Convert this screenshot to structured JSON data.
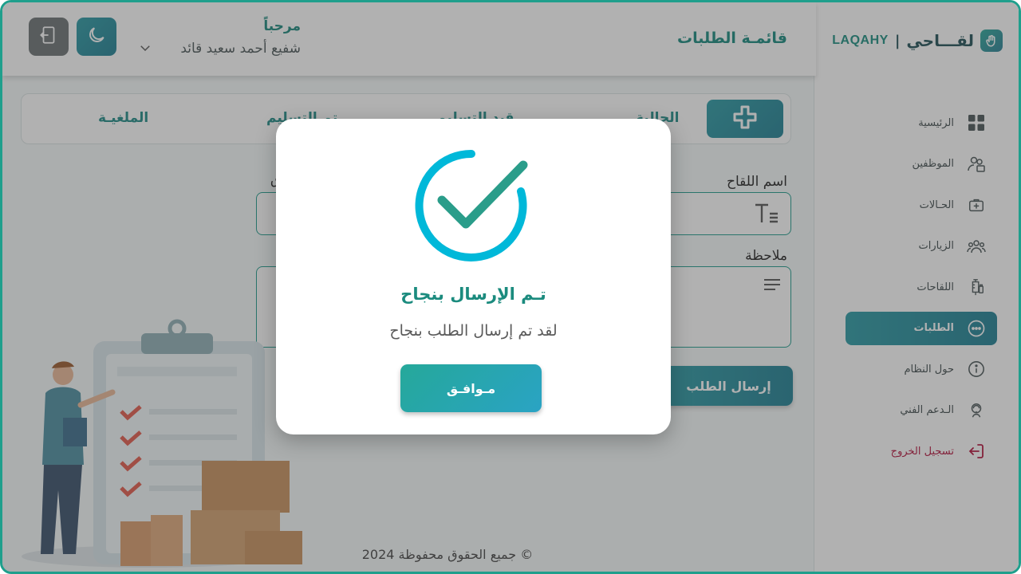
{
  "brand": {
    "arabic": "لقـــاحي",
    "separator": "|",
    "latin": "LAQAHY"
  },
  "sidebar": {
    "items": [
      {
        "label": "الرئيسية",
        "icon": "grid-icon"
      },
      {
        "label": "الموظفين",
        "icon": "staff-icon"
      },
      {
        "label": "الحـالات",
        "icon": "medkit-icon"
      },
      {
        "label": "الزيارات",
        "icon": "users-icon"
      },
      {
        "label": "اللقاحات",
        "icon": "syringe-icon"
      },
      {
        "label": "الطلبات",
        "icon": "chat-dots-icon"
      },
      {
        "label": "حول النظام",
        "icon": "info-icon"
      },
      {
        "label": "الـدعم الفني",
        "icon": "support-icon"
      },
      {
        "label": "تسجيل الخروج",
        "icon": "logout-icon"
      }
    ],
    "active_index": 5
  },
  "header": {
    "title": "قائمـة الطلبات",
    "greeting": "مرحباً",
    "user_name": "شفيع أحمد سعيد قائد"
  },
  "tabs": {
    "items": [
      "الحالية",
      "قيد التسليم",
      "تم التسليم",
      "الملغيـة"
    ]
  },
  "form": {
    "vaccine_label": "اسم اللقاح",
    "quantity_label": "ق",
    "note_label": "ملاحظة",
    "submit_label": "إرسال الطلب"
  },
  "footer": {
    "copyright": "جميع الحقوق محفوظة 2024 ©"
  },
  "modal": {
    "title": "تـم الإرسال بنجاح",
    "message": "لقد تم إرسال الطلب بنجاح",
    "ok_label": "مـوافـق"
  },
  "colors": {
    "accent": "#1f8b86",
    "danger": "#b3123b",
    "check_ring": "#00b8d9",
    "check_mark": "#2a9d8a"
  }
}
